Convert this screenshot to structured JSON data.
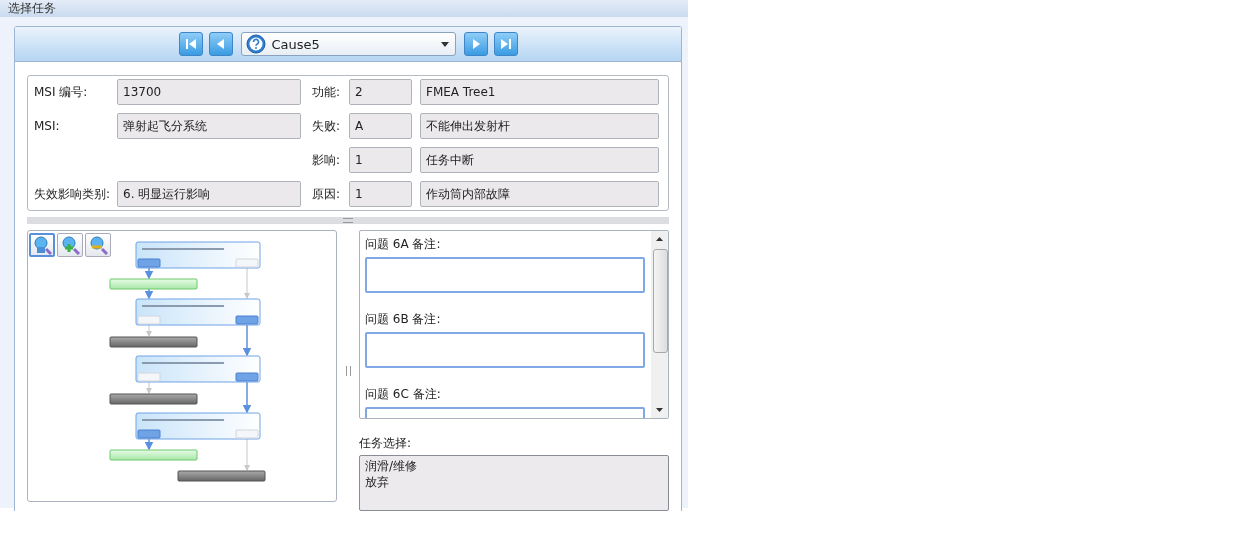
{
  "window": {
    "title": "选择任务"
  },
  "selector": {
    "value": "Cause5"
  },
  "info_rows": [
    {
      "label": "MSI 编号:",
      "value": "13700",
      "label2": "功能:",
      "code": "2",
      "text": "FMEA Tree1"
    },
    {
      "label": "MSI:",
      "value": "弹射起飞分系统",
      "label2": "失败:",
      "code": "A",
      "text": "不能伸出发射杆"
    },
    {
      "label2": "影响:",
      "code": "1",
      "text": "任务中断"
    },
    {
      "label": "失效影响类别:",
      "value": "6. 明显运行影响",
      "label2": "原因:",
      "code": "1",
      "text": "作动筒内部故障"
    }
  ],
  "zoom_tools": [
    {
      "selected": true
    },
    {
      "selected": false
    },
    {
      "selected": false
    }
  ],
  "flowchart": {
    "nodes": [
      {
        "answers": [
          {
            "selected": true
          },
          {
            "selected": false
          }
        ]
      },
      {
        "answers": [
          {
            "selected": false
          },
          {
            "selected": true
          }
        ]
      },
      {
        "answers": [
          {
            "selected": false
          },
          {
            "selected": true
          }
        ]
      },
      {
        "answers": [
          {
            "selected": true
          },
          {
            "selected": false
          }
        ]
      }
    ],
    "results": [
      {
        "kind": "green"
      },
      {
        "kind": "gray"
      },
      {
        "kind": "gray"
      },
      {
        "kind": "green"
      },
      {
        "kind": "gray"
      }
    ]
  },
  "questions": [
    {
      "label": "问题 6A 备注:"
    },
    {
      "label": "问题 6B 备注:"
    },
    {
      "label": "问题 6C 备注:"
    }
  ],
  "task_choice": {
    "label": "任务选择:",
    "items": [
      "润滑/维修",
      "放弃"
    ]
  }
}
